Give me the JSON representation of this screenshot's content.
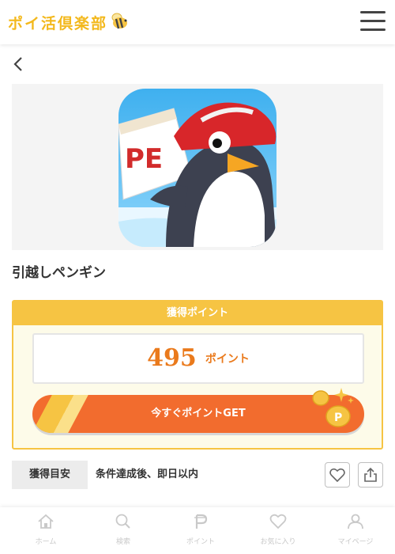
{
  "header": {
    "logo_text": "ポイ活倶楽部",
    "menu_icon": "hamburger-icon",
    "brand_color": "#f3b81c"
  },
  "nav": {
    "back_icon": "chevron-left-icon"
  },
  "app": {
    "title": "引越しペンギン",
    "icon_text": "PE"
  },
  "points": {
    "header_label": "獲得ポイント",
    "value": "495",
    "unit": "ポイント",
    "cta_label": "今すぐポイントGET",
    "accent_color": "#f26c2e",
    "frame_color": "#f6c443",
    "value_color": "#ea7a1c"
  },
  "meta": {
    "tag_label": "獲得目安",
    "text": "条件達成後、即日以内",
    "favorite_icon": "heart-icon",
    "share_icon": "share-icon"
  },
  "bottom_nav": [
    {
      "label": "ホーム",
      "icon": "home-icon"
    },
    {
      "label": "検索",
      "icon": "search-icon"
    },
    {
      "label": "ポイント",
      "icon": "point-icon"
    },
    {
      "label": "お気に入り",
      "icon": "heart-icon"
    },
    {
      "label": "マイページ",
      "icon": "user-icon"
    }
  ]
}
